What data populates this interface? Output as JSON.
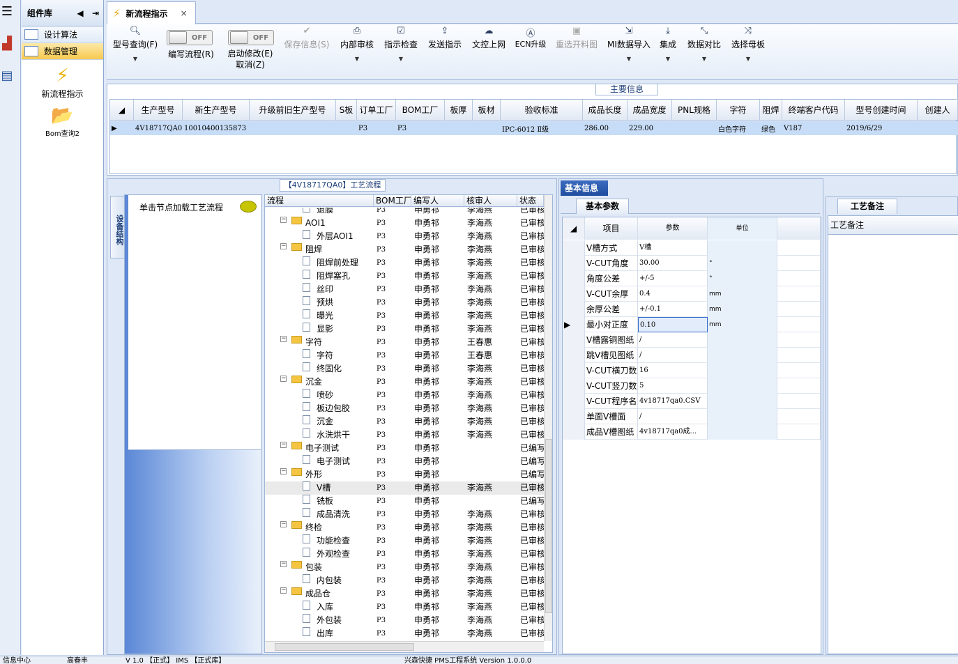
{
  "left_strip": {
    "icons": [
      "menu-icon",
      "factory-icon",
      "report-icon"
    ]
  },
  "library": {
    "title": "组件库",
    "groups": [
      {
        "label": "设计算法",
        "active": false
      },
      {
        "label": "数据管理",
        "active": true
      }
    ],
    "items": [
      {
        "label": "新流程指示",
        "icon": "bolt-icon"
      },
      {
        "label": "Bom查询2",
        "icon": "folder-icon"
      }
    ]
  },
  "tab": {
    "title": "新流程指示",
    "close": "×"
  },
  "toolbar": {
    "model_query": "型号查询(F)",
    "edit_flow": {
      "label": "编写流程(R)",
      "state": "OFF"
    },
    "start_edit": {
      "label": "启动修改(E)",
      "sub": "取消(Z)",
      "state": "OFF"
    },
    "save_info": "保存信息(S)",
    "internal_review": "内部审核",
    "instruction_check": "指示检查",
    "send_instruction": "发送指示",
    "doc_online": "文控上网",
    "ecn_upgrade": "ECN升级",
    "reselect_material": "重选开料图",
    "mi_import": "MI数据导入",
    "integrate": "集成",
    "data_compare": "数据对比",
    "select_mother": "选择母板"
  },
  "main_info": {
    "title": "主要信息",
    "columns": [
      "生产型号",
      "新生产型号",
      "升级前旧生产型号",
      "S板",
      "订单工厂",
      "BOM工厂",
      "板厚",
      "板材",
      "验收标准",
      "成品长度",
      "成品宽度",
      "PNL规格",
      "字符",
      "阻焊",
      "终端客户代码",
      "型号创建时间",
      "创建人"
    ],
    "rows": [
      [
        "4V18717QA0",
        "10010400135873",
        "",
        "",
        "P3",
        "P3",
        "",
        "",
        "IPC-6012 Ⅱ级",
        "286.00",
        "229.00",
        "",
        "白色字符",
        "绿色",
        "V187",
        "2019/6/29",
        ""
      ]
    ]
  },
  "process": {
    "title": "【4V18717QA0】工艺流程",
    "equip_tab": "设备结构",
    "equip_hint": "单击节点加载工艺流程",
    "columns": [
      "流程",
      "BOM工厂",
      "编写人",
      "核审人",
      "状态"
    ],
    "rows": [
      {
        "name": "退膜",
        "level": 2,
        "bom": "P3",
        "author": "申勇祁",
        "reviewer": "李海燕",
        "status": "已审核"
      },
      {
        "name": "AOI1",
        "level": 1,
        "bom": "P3",
        "author": "申勇祁",
        "reviewer": "李海燕",
        "status": "已审核"
      },
      {
        "name": "外层AOI1",
        "level": 2,
        "bom": "P3",
        "author": "申勇祁",
        "reviewer": "李海燕",
        "status": "已审核"
      },
      {
        "name": "阻焊",
        "level": 1,
        "bom": "P3",
        "author": "申勇祁",
        "reviewer": "李海燕",
        "status": "已审核"
      },
      {
        "name": "阻焊前处理",
        "level": 2,
        "bom": "P3",
        "author": "申勇祁",
        "reviewer": "李海燕",
        "status": "已审核"
      },
      {
        "name": "阻焊塞孔",
        "level": 2,
        "bom": "P3",
        "author": "申勇祁",
        "reviewer": "李海燕",
        "status": "已审核"
      },
      {
        "name": "丝印",
        "level": 2,
        "bom": "P3",
        "author": "申勇祁",
        "reviewer": "李海燕",
        "status": "已审核"
      },
      {
        "name": "预烘",
        "level": 2,
        "bom": "P3",
        "author": "申勇祁",
        "reviewer": "李海燕",
        "status": "已审核"
      },
      {
        "name": "曝光",
        "level": 2,
        "bom": "P3",
        "author": "申勇祁",
        "reviewer": "李海燕",
        "status": "已审核"
      },
      {
        "name": "显影",
        "level": 2,
        "bom": "P3",
        "author": "申勇祁",
        "reviewer": "李海燕",
        "status": "已审核"
      },
      {
        "name": "字符",
        "level": 1,
        "bom": "P3",
        "author": "申勇祁",
        "reviewer": "王春惠",
        "status": "已审核"
      },
      {
        "name": "字符",
        "level": 2,
        "bom": "P3",
        "author": "申勇祁",
        "reviewer": "王春惠",
        "status": "已审核"
      },
      {
        "name": "终固化",
        "level": 2,
        "bom": "P3",
        "author": "申勇祁",
        "reviewer": "李海燕",
        "status": "已审核"
      },
      {
        "name": "沉金",
        "level": 1,
        "bom": "P3",
        "author": "申勇祁",
        "reviewer": "李海燕",
        "status": "已审核"
      },
      {
        "name": "喷砂",
        "level": 2,
        "bom": "P3",
        "author": "申勇祁",
        "reviewer": "李海燕",
        "status": "已审核"
      },
      {
        "name": "板边包胶",
        "level": 2,
        "bom": "P3",
        "author": "申勇祁",
        "reviewer": "李海燕",
        "status": "已审核"
      },
      {
        "name": "沉金",
        "level": 2,
        "bom": "P3",
        "author": "申勇祁",
        "reviewer": "李海燕",
        "status": "已审核"
      },
      {
        "name": "水洗烘干",
        "level": 2,
        "bom": "P3",
        "author": "申勇祁",
        "reviewer": "李海燕",
        "status": "已审核"
      },
      {
        "name": "电子测试",
        "level": 1,
        "bom": "P3",
        "author": "申勇祁",
        "reviewer": "",
        "status": "已编写"
      },
      {
        "name": "电子测试",
        "level": 2,
        "bom": "P3",
        "author": "申勇祁",
        "reviewer": "",
        "status": "已编写"
      },
      {
        "name": "外形",
        "level": 1,
        "bom": "P3",
        "author": "申勇祁",
        "reviewer": "",
        "status": "已编写"
      },
      {
        "name": "V槽",
        "level": 2,
        "bom": "P3",
        "author": "申勇祁",
        "reviewer": "李海燕",
        "status": "已审核",
        "selected": true
      },
      {
        "name": "铣板",
        "level": 2,
        "bom": "P3",
        "author": "申勇祁",
        "reviewer": "",
        "status": "已编写"
      },
      {
        "name": "成品清洗",
        "level": 2,
        "bom": "P3",
        "author": "申勇祁",
        "reviewer": "李海燕",
        "status": "已审核"
      },
      {
        "name": "终检",
        "level": 1,
        "bom": "P3",
        "author": "申勇祁",
        "reviewer": "李海燕",
        "status": "已审核"
      },
      {
        "name": "功能检查",
        "level": 2,
        "bom": "P3",
        "author": "申勇祁",
        "reviewer": "李海燕",
        "status": "已审核"
      },
      {
        "name": "外观检查",
        "level": 2,
        "bom": "P3",
        "author": "申勇祁",
        "reviewer": "李海燕",
        "status": "已审核"
      },
      {
        "name": "包装",
        "level": 1,
        "bom": "P3",
        "author": "申勇祁",
        "reviewer": "李海燕",
        "status": "已审核"
      },
      {
        "name": "内包装",
        "level": 2,
        "bom": "P3",
        "author": "申勇祁",
        "reviewer": "李海燕",
        "status": "已审核"
      },
      {
        "name": "成品仓",
        "level": 1,
        "bom": "P3",
        "author": "申勇祁",
        "reviewer": "李海燕",
        "status": "已审核"
      },
      {
        "name": "入库",
        "level": 2,
        "bom": "P3",
        "author": "申勇祁",
        "reviewer": "李海燕",
        "status": "已审核"
      },
      {
        "name": "外包装",
        "level": 2,
        "bom": "P3",
        "author": "申勇祁",
        "reviewer": "李海燕",
        "status": "已审核"
      },
      {
        "name": "出库",
        "level": 2,
        "bom": "P3",
        "author": "申勇祁",
        "reviewer": "李海燕",
        "status": "已审核"
      }
    ]
  },
  "basic_info": {
    "title": "基本信息",
    "sub_tab": "基本参数",
    "columns": [
      "项目",
      "参数",
      "单位"
    ],
    "rows": [
      {
        "item": "V槽方式",
        "value": "V槽",
        "unit": ""
      },
      {
        "item": "V-CUT角度",
        "value": "30.00",
        "unit": "°"
      },
      {
        "item": "角度公差",
        "value": "+/-5",
        "unit": "°"
      },
      {
        "item": "V-CUT余厚",
        "value": "0.4",
        "unit": "mm"
      },
      {
        "item": "余厚公差",
        "value": "+/-0.1",
        "unit": "mm"
      },
      {
        "item": "最小对正度",
        "value": "0.10",
        "unit": "mm",
        "current": true
      },
      {
        "item": "V槽露铜图纸",
        "value": "/",
        "unit": ""
      },
      {
        "item": "跳V槽见图纸",
        "value": "/",
        "unit": ""
      },
      {
        "item": "V-CUT横刀数",
        "value": "16",
        "unit": ""
      },
      {
        "item": "V-CUT竖刀数",
        "value": "5",
        "unit": ""
      },
      {
        "item": "V-CUT程序名",
        "value": "4v18717qa0.CSV",
        "unit": ""
      },
      {
        "item": "单面V槽面",
        "value": "/",
        "unit": ""
      },
      {
        "item": "成品V槽图纸",
        "value": "4v18717qa0成...",
        "unit": ""
      }
    ]
  },
  "process_note": {
    "tab": "工艺备注",
    "column": "工艺备注"
  },
  "status_bar": {
    "left": "信息中心",
    "user": "高春丰",
    "mid": "V 1.0 【正式】 IMS 【正式库】",
    "right": "兴森快捷 PMS工程系统 Version 1.0.0.0"
  }
}
